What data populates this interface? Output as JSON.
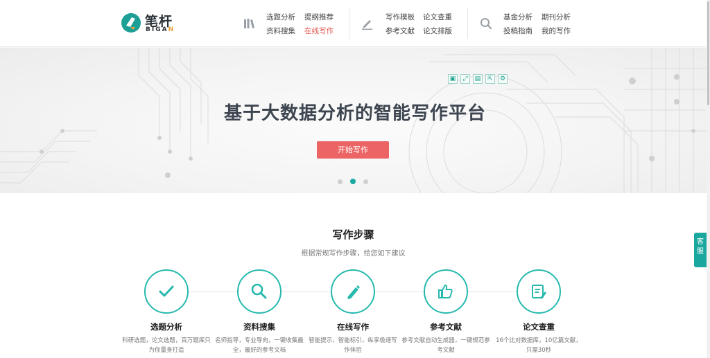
{
  "logo": {
    "cn": "笔杆",
    "en_main": "BIGA",
    "en_accent": "N"
  },
  "nav": {
    "group1": [
      "选题分析",
      "提纲推荐",
      "资料搜集",
      "在线写作"
    ],
    "group2": [
      "写作模板",
      "论文查重",
      "参考文献",
      "论文排版"
    ],
    "group3": [
      "基金分析",
      "期刊分析",
      "投稿指南",
      "我的写作"
    ],
    "active": "在线写作"
  },
  "banner": {
    "title": "基于大数据分析的智能写作平台",
    "button": "开始写作",
    "slides": 3,
    "active_slide": 2
  },
  "toolbar": {
    "icons": [
      "image-icon",
      "fullscreen-icon",
      "save-icon",
      "export-icon",
      "settings-icon"
    ]
  },
  "steps": {
    "title": "写作步骤",
    "subtitle": "根据常规写作步骤，给您如下建议",
    "items": [
      {
        "name": "选题分析",
        "desc": "科研选题，论文选题，百万题库只为你量身打造",
        "icon": "check-icon"
      },
      {
        "name": "资料搜集",
        "desc": "名师指导，专业导向，一键收集最全，最好的参考文档",
        "icon": "search-icon"
      },
      {
        "name": "在线写作",
        "desc": "智能提示，智能标引，纵享极速写作体验",
        "icon": "pen-icon"
      },
      {
        "name": "参考文献",
        "desc": "参考文献自动生成器，一键规范参考文献",
        "icon": "thumbs-up-icon"
      },
      {
        "name": "论文查重",
        "desc": "16个比对数据库，10亿篇文献，只需30秒",
        "icon": "document-edit-icon"
      }
    ]
  },
  "service": {
    "chars": [
      "客",
      "服"
    ]
  },
  "colors": {
    "accent": "#19a9a2",
    "button": "#ec6464",
    "active_link": "#e2574c"
  }
}
